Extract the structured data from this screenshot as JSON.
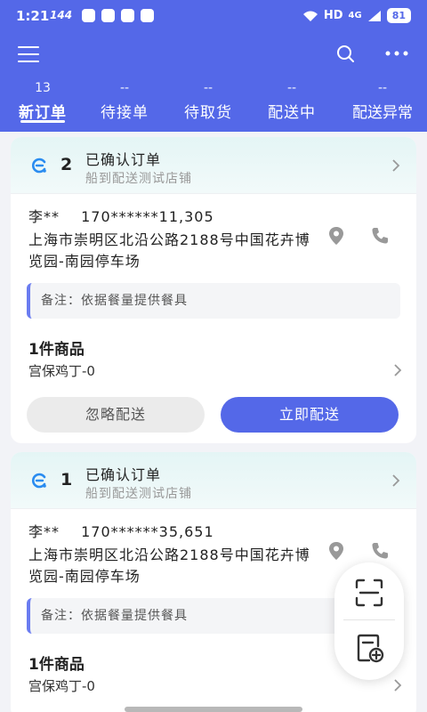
{
  "status_bar": {
    "time": "1:21",
    "network_speed": "144",
    "network": "HD",
    "signal": "4G",
    "battery": "81"
  },
  "header": {
    "menu_icon": "menu-icon",
    "search_icon": "search-icon",
    "more_icon": "more-icon",
    "tabs": [
      {
        "count": "13",
        "label": "新订单",
        "active": true
      },
      {
        "count": "--",
        "label": "待接单",
        "active": false
      },
      {
        "count": "--",
        "label": "待取货",
        "active": false
      },
      {
        "count": "--",
        "label": "配送中",
        "active": false
      },
      {
        "count": "--",
        "label": "配送异常",
        "active": false
      }
    ]
  },
  "orders": [
    {
      "number": "2",
      "status": "已确认订单",
      "store": "船到配送测试店铺",
      "customer_name": "李**",
      "customer_phone": "170******11,305",
      "address": "上海市崇明区北沿公路2188号中国花卉博览园-南园停车场",
      "remark": "备注：依据餐量提供餐具",
      "items_title": "1件商品",
      "item": "宫保鸡丁-0",
      "ignore_label": "忽略配送",
      "deliver_label": "立即配送"
    },
    {
      "number": "1",
      "status": "已确认订单",
      "store": "船到配送测试店铺",
      "customer_name": "李**",
      "customer_phone": "170******35,651",
      "address": "上海市崇明区北沿公路2188号中国花卉博览园-南园停车场",
      "remark": "备注：依据餐量提供餐具",
      "items_title": "1件商品",
      "item": "宫保鸡丁-0"
    }
  ],
  "fab": {
    "scan_icon": "scan-icon",
    "add_order_icon": "add-order-icon"
  },
  "colors": {
    "primary": "#5468e8",
    "card_head": "#e4f5f5",
    "background": "#f2f3f7"
  }
}
